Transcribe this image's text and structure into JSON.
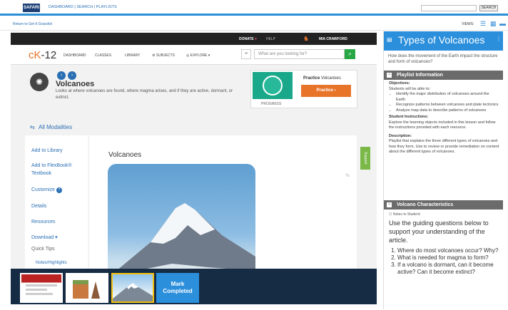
{
  "topbar": {
    "logo": "SAFARI",
    "nav": "DASHBOARD | SEARCH | PLAYLISTS",
    "search_button": "SEARCH"
  },
  "subbar": {
    "return_link": "Return to Get It Grasslist",
    "views_label": "VIEWS:"
  },
  "ck12": {
    "donate": "DONATE",
    "help": "HELP",
    "username": "MIA CRAWFORD",
    "logo_prefix": "cK",
    "logo_suffix": "-12",
    "nav": [
      "DASHBOARD",
      "CLASSES",
      "LIBRARY",
      "SUBJECTS",
      "EXPLORE"
    ],
    "search_placeholder": "What are you looking for?",
    "concept_title": "Volcanoes",
    "concept_desc": "Looks at where volcanoes are found, where magma arises, and if they are active, dormant, or extinct.",
    "practice_prefix": "Practice",
    "practice_topic": "Volcanoes",
    "practice_button": "Practice",
    "progress_label": "PROGRESS",
    "modalities": "All Modalities",
    "side_links": [
      "Add to Library",
      "Add to FlexBook®",
      "Textbook",
      "Customize",
      "Details",
      "Resources",
      "Download"
    ],
    "quick_tips": "Quick Tips",
    "notes_highlights": "Notes/Highlights",
    "content_title": "Volcanoes",
    "support_tab": "Support"
  },
  "filmstrip": {
    "mark_completed_line1": "Mark",
    "mark_completed_line2": "Completed"
  },
  "right_panel": {
    "title": "Types of Volcanoes",
    "question": "How does the movement of the Earth impact the structure and form of volcanoes?",
    "playlist_heading": "Playlist Information",
    "objectives_label": "Objectives:",
    "objectives_intro": "Students will be able to:",
    "objectives": [
      "Identify the major distribution of volcanoes around the Earth",
      "Recognize patterns between volcanoes and plate tectonics",
      "Analyze map data to describe patterns of volcanoes"
    ],
    "instructions_label": "Student Instructions:",
    "instructions": "Explore the learning objects included in this lesson and follow the instructions provided with each resource.",
    "description_label": "Description:",
    "description": "Playlist that explains the three different types of volcanoes and how they form. Use to review or provide remediation on content about the different types of volcanoes.",
    "vc_heading": "Volcano Characteristics",
    "notes_label": "Notes to Student:",
    "guiding": "Use the guiding questions below to support your understanding of the article.",
    "questions": [
      "Where do most volcanoes occur? Why?",
      "What is needed for magma to form?",
      "If a volcano is dormant, can it become active? Can it become extinct?"
    ]
  },
  "colors": {
    "accent_blue": "#2b8fdc",
    "practice_orange": "#e8742a",
    "search_green": "#27a844",
    "filmstrip_bg": "#162c45",
    "selected_thumb_border": "#f4c20d"
  }
}
